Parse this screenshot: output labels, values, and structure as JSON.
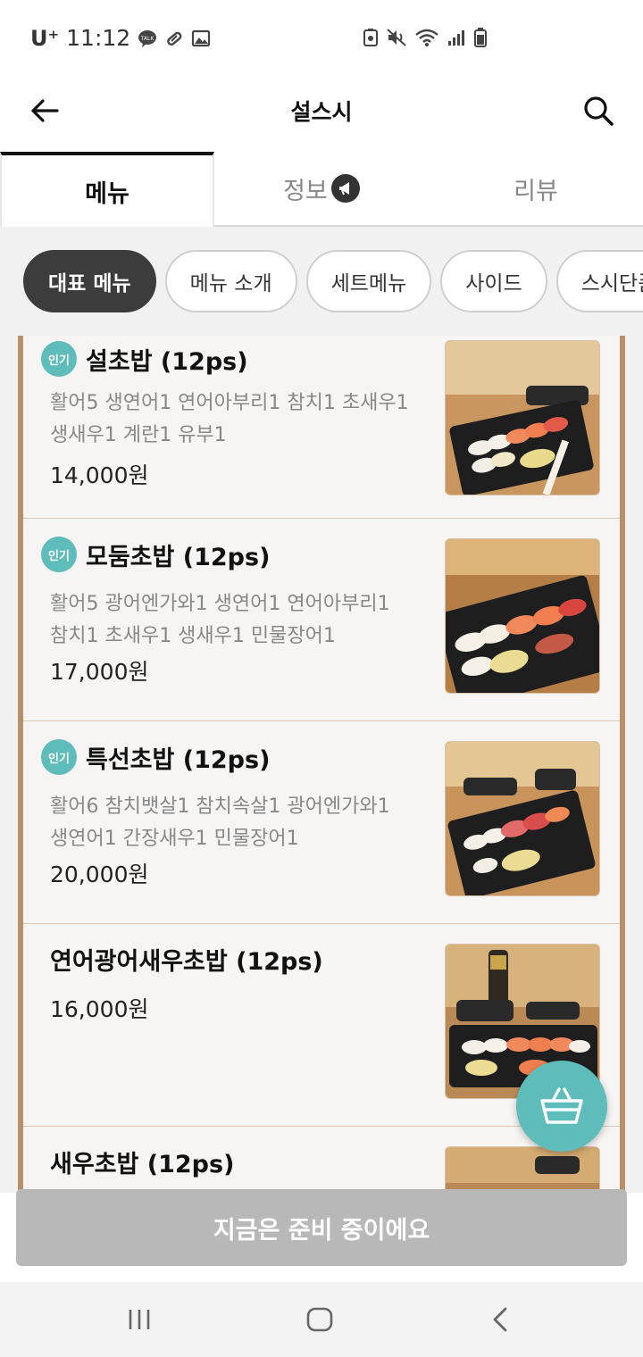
{
  "status_bar": {
    "carrier": "U⁺",
    "time": "11:12",
    "left_icons": [
      "talk-icon",
      "pill-icon",
      "image-icon"
    ],
    "right_icons": [
      "battery-saver-icon",
      "mute-icon",
      "wifi-icon",
      "signal-icon",
      "battery-icon"
    ]
  },
  "header": {
    "title": "설스시",
    "back_icon": "arrow-left-icon",
    "search_icon": "search-icon"
  },
  "tabs": [
    {
      "label": "메뉴",
      "active": true
    },
    {
      "label": "정보",
      "active": false,
      "icon": "megaphone-icon"
    },
    {
      "label": "리뷰",
      "active": false
    }
  ],
  "categories": [
    {
      "label": "대표 메뉴",
      "active": true
    },
    {
      "label": "메뉴 소개",
      "active": false
    },
    {
      "label": "세트메뉴",
      "active": false
    },
    {
      "label": "사이드",
      "active": false
    },
    {
      "label": "스시단품메뉴",
      "active": false
    }
  ],
  "menu_items": [
    {
      "badge": "인기",
      "name": "설초밥 (12ps)",
      "desc_line1": "활어5 생연어1 연어아부리1 참치1 초새우1",
      "desc_line2": "생새우1 계란1 유부1",
      "price": "14,000원"
    },
    {
      "badge": "인기",
      "name": "모둠초밥 (12ps)",
      "desc_line1": "활어5 광어엔가와1 생연어1 연어아부리1",
      "desc_line2": "참치1 초새우1 생새우1 민물장어1",
      "price": "17,000원"
    },
    {
      "badge": "인기",
      "name": "특선초밥 (12ps)",
      "desc_line1": "활어6 참치뱃살1 참치속살1  광어엔가와1",
      "desc_line2": "생연어1 간장새우1 민물장어1",
      "price": "20,000원"
    },
    {
      "name": "연어광어새우초밥 (12ps)",
      "price": "16,000원"
    },
    {
      "name": "새우초밥 (12ps)"
    }
  ],
  "cart_button_icon": "basket-icon",
  "order_bar": {
    "label": "지금은 준비 중이에요"
  },
  "nav_bar": {
    "icons": [
      "recent-apps-icon",
      "home-icon",
      "back-icon"
    ]
  },
  "colors": {
    "accent": "#5ebdba",
    "frame": "#b6906a",
    "disabled": "#b8b8b8",
    "chip_active": "#3c3c3c"
  }
}
